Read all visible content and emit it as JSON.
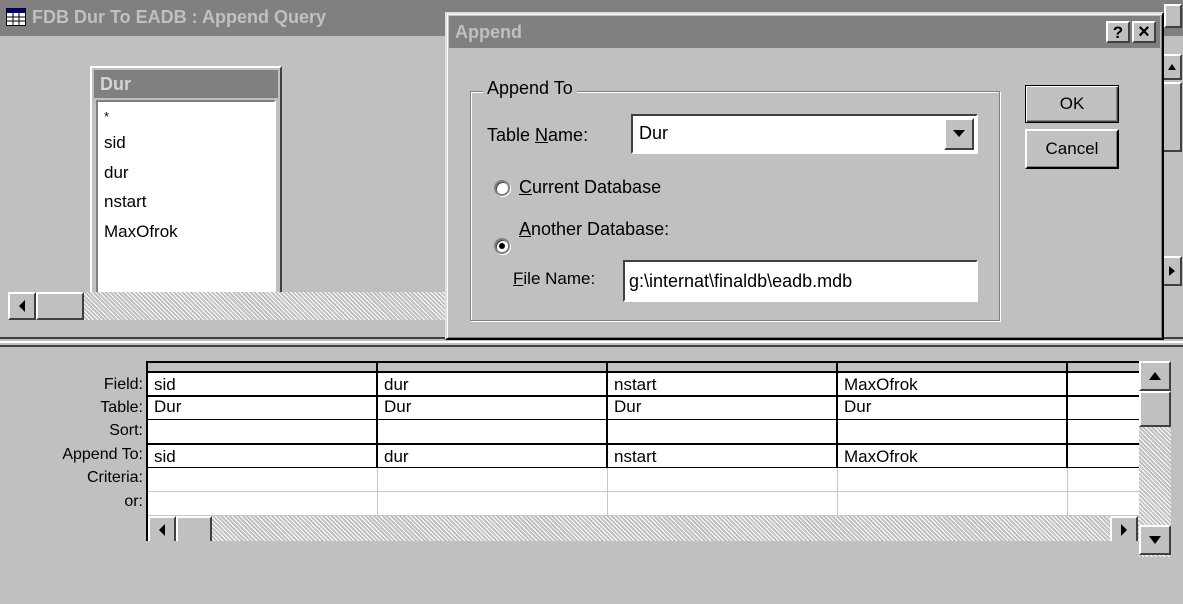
{
  "query_window": {
    "title": "FDB Dur To EADB : Append Query",
    "table_box": {
      "name": "Dur",
      "fields": [
        "*",
        "sid",
        "dur",
        "nstart",
        "MaxOfrok"
      ]
    }
  },
  "grid": {
    "row_labels": [
      "Field:",
      "Table:",
      "Sort:",
      "Append To:",
      "Criteria:",
      "or:"
    ],
    "columns": [
      {
        "field": "sid",
        "table": "Dur",
        "sort": "",
        "append_to": "sid",
        "criteria": "",
        "or": ""
      },
      {
        "field": "dur",
        "table": "Dur",
        "sort": "",
        "append_to": "dur",
        "criteria": "",
        "or": ""
      },
      {
        "field": "nstart",
        "table": "Dur",
        "sort": "",
        "append_to": "nstart",
        "criteria": "",
        "or": ""
      },
      {
        "field": "MaxOfrok",
        "table": "Dur",
        "sort": "",
        "append_to": "MaxOfrok",
        "criteria": "",
        "or": ""
      }
    ]
  },
  "dialog": {
    "title": "Append",
    "help_glyph": "?",
    "close_glyph": "×",
    "group_label": "Append To",
    "table_name_label_pre": "Table ",
    "table_name_label_u": "N",
    "table_name_label_post": "ame:",
    "table_name_value": "Dur",
    "current_db_u": "C",
    "current_db_rest": "urrent Database",
    "another_db_u": "A",
    "another_db_rest": "nother Database:",
    "file_name_u": "F",
    "file_name_rest": "ile Name:",
    "file_name_value": "g:\\internat\\finaldb\\eadb.mdb",
    "ok_label": "OK",
    "cancel_label": "Cancel",
    "selected_option": "another_database"
  }
}
